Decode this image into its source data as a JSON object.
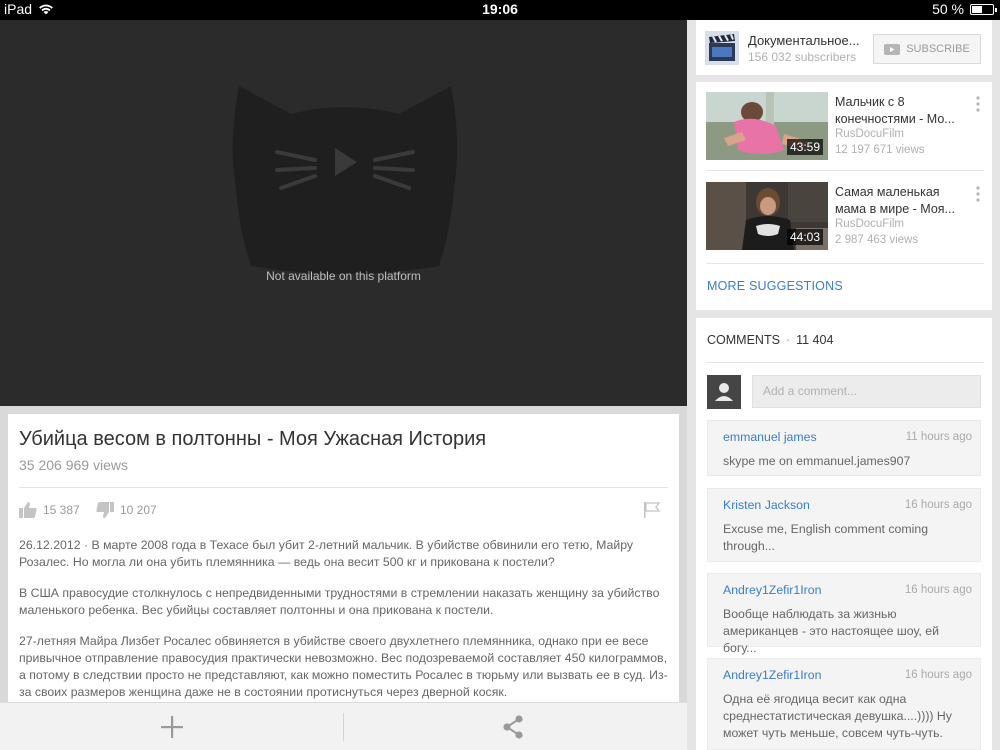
{
  "status": {
    "device": "iPad",
    "time": "19:06",
    "battery": "50 %",
    "battery_level": 0.5
  },
  "player": {
    "message": "Not available on this platform"
  },
  "video": {
    "title": "Убийца весом в полтонны - Моя Ужасная История",
    "views": "35 206 969 views",
    "likes": "15 387",
    "dislikes": "10 207",
    "description": [
      "26.12.2012  ·  В марте 2008 года в Техасе был убит 2-летний мальчик. В убийстве обвинили его тетю, Майру Розалес. Но могла ли она убить племянника — ведь она весит 500 кг и прикована к постели?",
      "В США правосудие столкнулось с непредвиденными трудностями в стремлении наказать женщину за убийство маленького ребенка. Вес убийцы составляет полтонны и она прикована к постели.",
      "27-летняя Майра Лизбет Росалес обвиняется в убийстве своего двухлетнего племянника, однако при ее весе привычное отправление правосудия практически невозможно. Вес подозреваемой составляет 450 килограммов, а потому в следствии просто не представляют, как можно поместить Росалес в тюрьму или вызвать ее в суд. Из-за своих размеров женщина даже не в состоянии протиснуться через дверной косяк."
    ]
  },
  "channel": {
    "name": "Документальное...",
    "subscribers": "156 032 subscribers",
    "subscribe_label": "SUBSCRIBE"
  },
  "suggestions": [
    {
      "title": "Мальчик с 8 конечностями - Мо...",
      "channel": "RusDocuFilm",
      "views": "12 197 671 views",
      "duration": "43:59"
    },
    {
      "title": "Самая маленькая мама в мире - Моя...",
      "channel": "RusDocuFilm",
      "views": "2 987 463 views",
      "duration": "44:03"
    }
  ],
  "more_suggestions_label": "MORE SUGGESTIONS",
  "comments": {
    "header": "COMMENTS",
    "count": "11 404",
    "placeholder": "Add a comment...",
    "items": [
      {
        "user": "emmanuel james",
        "time": "11 hours ago",
        "text": "skype me on emmanuel.james907"
      },
      {
        "user": "Kristen Jackson",
        "time": "16 hours ago",
        "text": "Excuse me, English comment coming through..."
      },
      {
        "user": "Andrey1Zefir1Iron",
        "time": "16 hours ago",
        "text": "Вообще наблюдать за жизнью американцев - это настоящее шоу, ей богу..."
      },
      {
        "user": "Andrey1Zefir1Iron",
        "time": "16 hours ago",
        "text": "Одна её ягодица весит как одна среднестатистическая девушка....)))) Ну может чуть меньше, совсем чуть-чуть."
      }
    ]
  }
}
